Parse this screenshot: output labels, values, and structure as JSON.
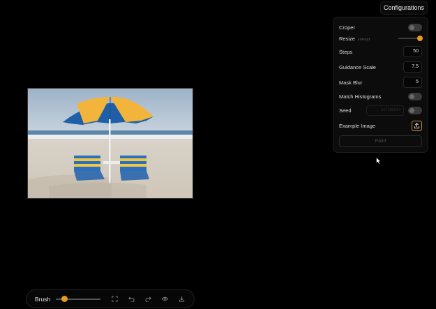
{
  "header": {
    "title": "Configurations"
  },
  "panel": {
    "croper": {
      "label": "Croper",
      "enabled": false
    },
    "resize": {
      "label": "Resize",
      "size_text": "474×317",
      "value": 1.0
    },
    "steps": {
      "label": "Steps",
      "value": "50"
    },
    "guidance": {
      "label": "Guidance Scale",
      "value": "7.5"
    },
    "mask_blur": {
      "label": "Mask Blur",
      "value": "5"
    },
    "match_histograms": {
      "label": "Match Histograms",
      "enabled": false
    },
    "seed": {
      "label": "Seed",
      "value": "917182814",
      "enabled": false
    },
    "example_image": {
      "label": "Example Image",
      "icon": "upload-icon"
    },
    "paint_button": "Paint"
  },
  "toolbar": {
    "tool_label": "Brush",
    "brush_size": 0.15,
    "icons": [
      "fullscreen-icon",
      "undo-icon",
      "redo-icon",
      "eye-icon",
      "download-icon"
    ]
  },
  "colors": {
    "accent": "#e69b23"
  }
}
